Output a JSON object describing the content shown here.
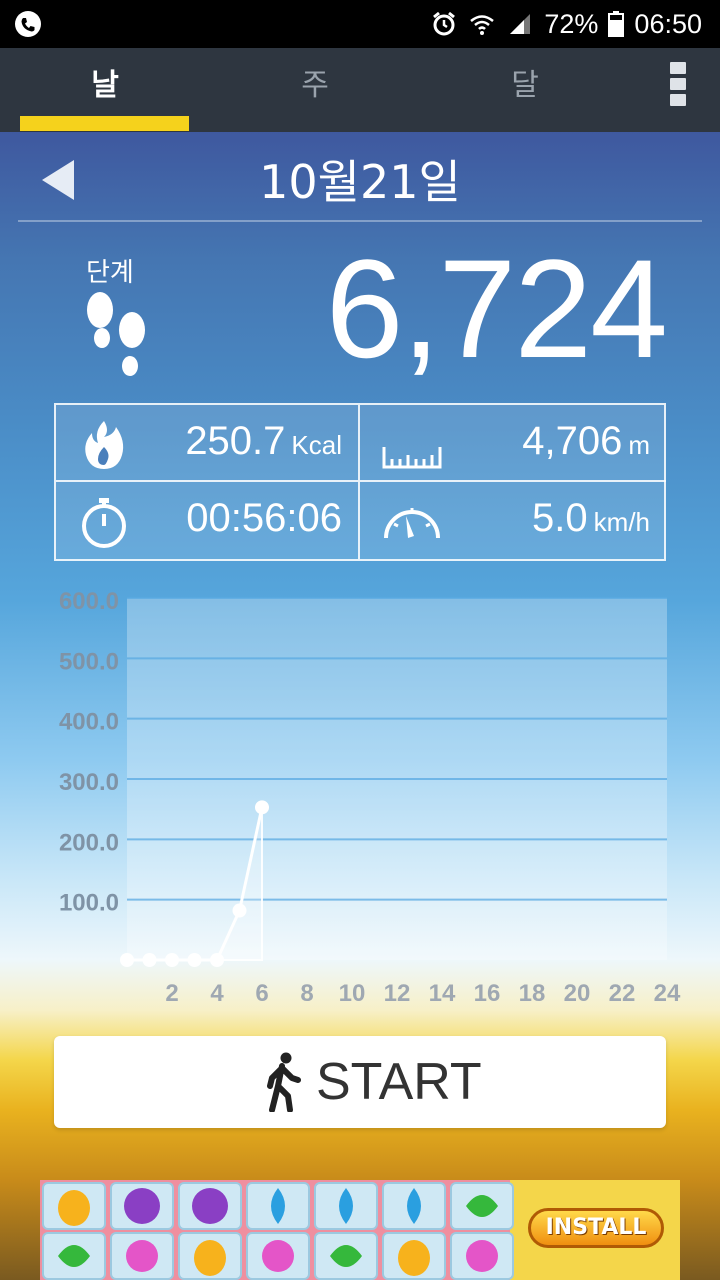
{
  "status_bar": {
    "battery": "72%",
    "time": "06:50",
    "left_icon": "phone-icon",
    "icons": [
      "alarm-icon",
      "wifi-icon",
      "signal-icon",
      "battery-icon"
    ]
  },
  "tabs": [
    {
      "label": "날",
      "active": true
    },
    {
      "label": "주",
      "active": false
    },
    {
      "label": "달",
      "active": false
    }
  ],
  "header": {
    "date": "10월21일"
  },
  "steps": {
    "label": "단계",
    "value": "6,724"
  },
  "stats": {
    "calories": {
      "value": "250.7",
      "unit": "Kcal",
      "icon": "flame-icon"
    },
    "distance": {
      "value": "4,706",
      "unit": "m",
      "icon": "ruler-icon"
    },
    "duration": {
      "value": "00:56:06",
      "unit": "",
      "icon": "stopwatch-icon"
    },
    "speed": {
      "value": "5.0",
      "unit": "km/h",
      "icon": "speedometer-icon"
    }
  },
  "chart_data": {
    "type": "line",
    "x": [
      1,
      2,
      3,
      4,
      5,
      6,
      7
    ],
    "values": [
      0,
      0,
      0,
      0,
      0,
      82,
      253
    ],
    "xticks": [
      "2",
      "4",
      "6",
      "8",
      "10",
      "12",
      "14",
      "16",
      "18",
      "20",
      "22",
      "24"
    ],
    "yticks": [
      "100.0",
      "200.0",
      "300.0",
      "400.0",
      "500.0",
      "600.0"
    ],
    "xlim": [
      0,
      24
    ],
    "ylim": [
      0,
      600
    ],
    "grid": true
  },
  "start_button": {
    "label": "START",
    "icon": "walker-icon"
  },
  "ad": {
    "install_label": "INSTALL"
  }
}
